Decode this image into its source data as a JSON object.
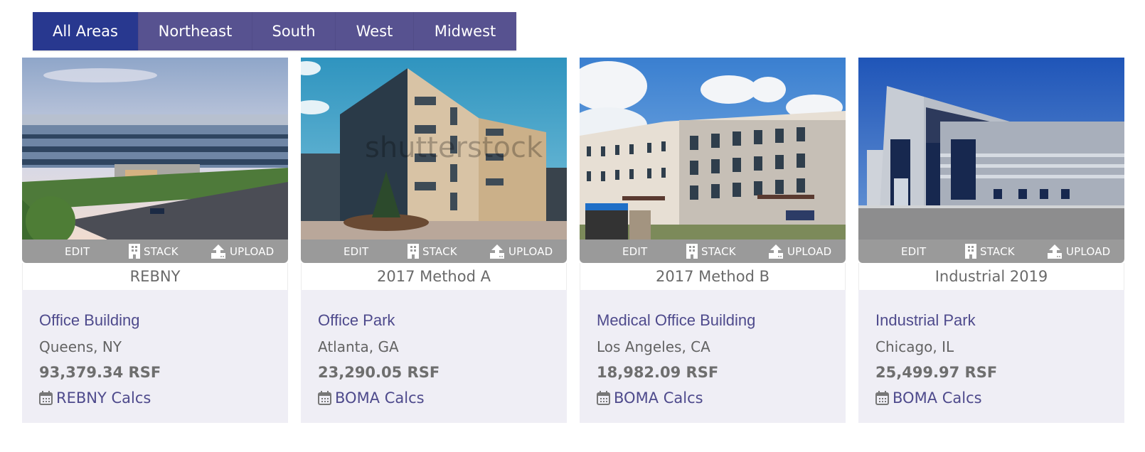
{
  "region_tabs": [
    {
      "label": "All Areas",
      "active": true
    },
    {
      "label": "Northeast",
      "active": false
    },
    {
      "label": "South",
      "active": false
    },
    {
      "label": "West",
      "active": false
    },
    {
      "label": "Midwest",
      "active": false
    }
  ],
  "actions": {
    "edit": "EDIT",
    "stack": "STACK",
    "upload": "UPLOAD"
  },
  "properties": [
    {
      "image_desc": "Glass office building beside multi-lane road at dusk",
      "method": "REBNY",
      "property_type": "Office Building",
      "location": "Queens, NY",
      "rsf": "93,379.34 RSF",
      "calcs_link": "REBNY Calcs"
    },
    {
      "image_desc": "Modern mid-rise residential building with balconies",
      "method": "2017 Method A",
      "property_type": "Office Park",
      "location": "Atlanta, GA",
      "rsf": "23,290.05 RSF",
      "calcs_link": "BOMA Calcs"
    },
    {
      "image_desc": "Four-story medical office building under cloudy blue sky",
      "method": "2017 Method B",
      "property_type": "Medical Office Building",
      "location": "Los Angeles, CA",
      "rsf": "18,982.09 RSF",
      "calcs_link": "BOMA Calcs"
    },
    {
      "image_desc": "Grey industrial warehouse with blue glass entry",
      "method": "Industrial 2019",
      "property_type": "Industrial Park",
      "location": "Chicago, IL",
      "rsf": "25,499.97 RSF",
      "calcs_link": "BOMA Calcs"
    }
  ],
  "colors": {
    "tab_active": "#28388f",
    "tab_inactive": "#575290",
    "link": "#4e4a8c",
    "action_bar": "#9a9a9a",
    "info_bg": "#efeef5"
  }
}
